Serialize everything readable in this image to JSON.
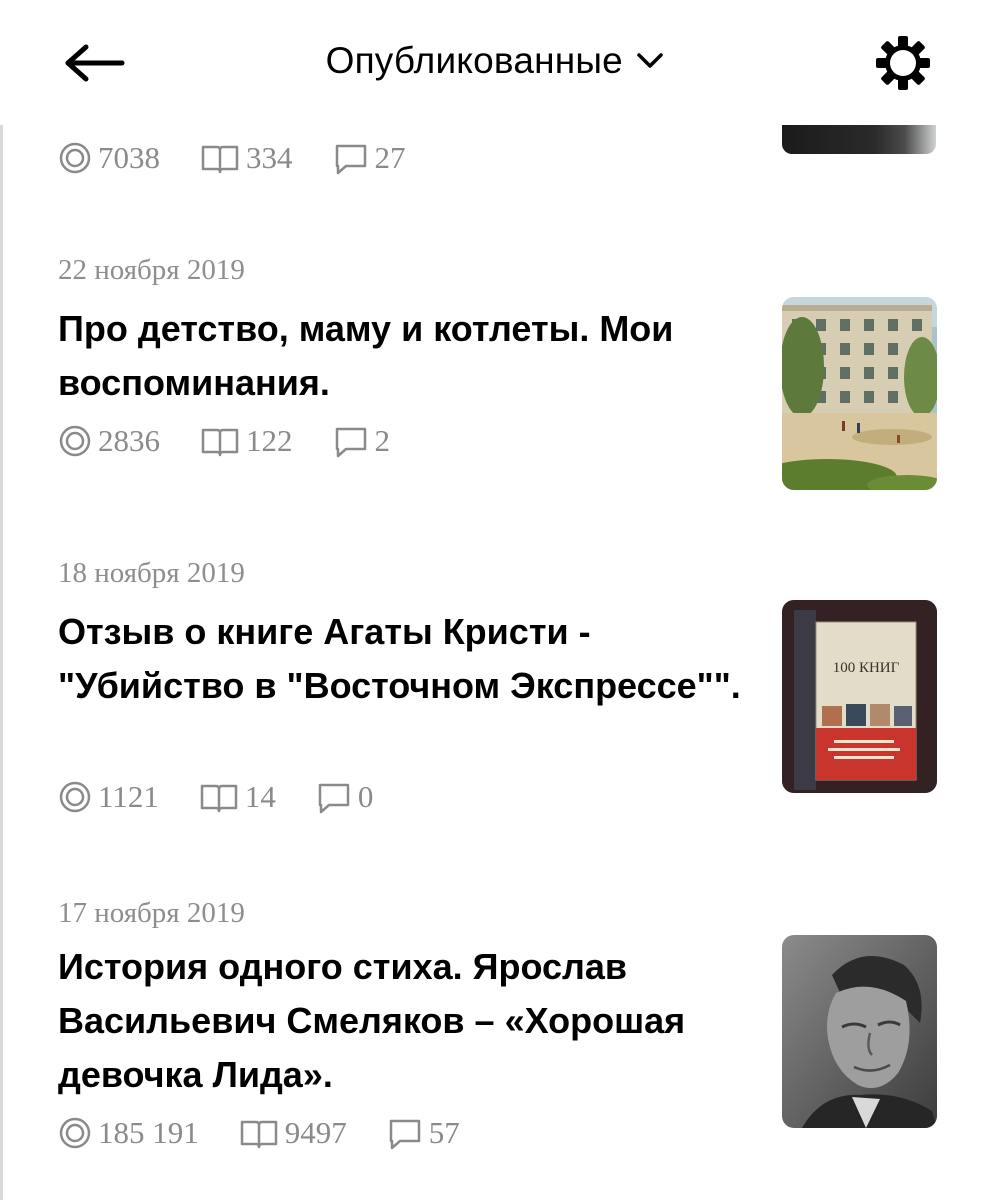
{
  "header": {
    "title": "Опубликованные"
  },
  "icons": {
    "back": "arrow-left-icon",
    "dropdown": "chevron-down-icon",
    "settings": "gear-icon",
    "views": "eye-icon",
    "reads": "book-icon",
    "comments": "comment-icon"
  },
  "colors": {
    "text": "#000000",
    "muted": "#8a8a8a",
    "background": "#ffffff"
  },
  "partial_item": {
    "views": "7038",
    "reads": "334",
    "comments": "27"
  },
  "articles": [
    {
      "date": "22 ноября 2019",
      "title": "Про детство, маму и котлеты. Мои воспоминания.",
      "views": "2836",
      "reads": "122",
      "comments": "2"
    },
    {
      "date": "18 ноября 2019",
      "title": "Отзыв о книге Агаты Кристи - \"Убийство в \"Восточном Экспрессе\"\".",
      "views": "1121",
      "reads": "14",
      "comments": "0",
      "cover_text": "100 КНИГ"
    },
    {
      "date": "17 ноября 2019",
      "title": "История одного стиха. Ярослав Васильевич Смеляков – «Хорошая девочка Лида».",
      "views": "185 191",
      "reads": "9497",
      "comments": "57"
    }
  ]
}
